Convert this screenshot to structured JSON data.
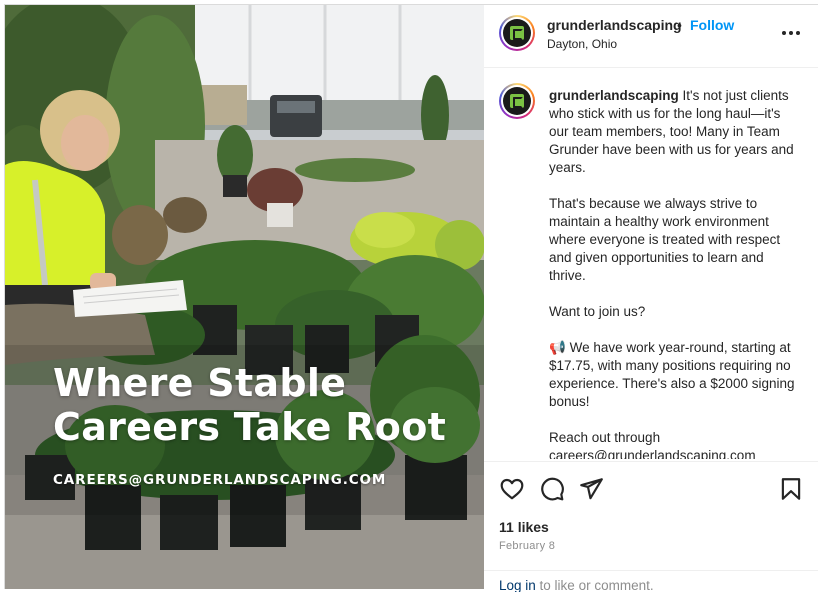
{
  "post": {
    "headline_line1": "Where Stable",
    "headline_line2": "Careers Take Root",
    "email_overlay": "CAREERS@GRUNDERLANDSCAPING.COM"
  },
  "header": {
    "username": "grunderlandscaping",
    "separator": "•",
    "follow_label": "Follow",
    "location": "Dayton, Ohio",
    "more_icon": "more-horizontal-icon"
  },
  "caption": {
    "username": "grunderlandscaping",
    "p1": "It's not just clients who stick with us for the long haul—it's our team members, too! Many in Team Grunder have been with us for years and years.",
    "p2": "That's because we always strive to maintain a healthy work environment where everyone is treated with respect and given opportunities to learn and thrive.",
    "p3": "Want to join us?",
    "p4_emoji": "📢",
    "p4": "We have work year-round, starting at $17.75, with many positions requiring no experience. There's also a $2000 signing bonus!",
    "p5": "Reach out through careers@grunderlandscaping.com"
  },
  "actions": {
    "like_icon": "heart-icon",
    "comment_icon": "comment-icon",
    "share_icon": "send-icon",
    "save_icon": "bookmark-icon",
    "likes": "11 likes",
    "date": "February 8",
    "login_link": "Log in",
    "login_suffix": " to like or comment."
  },
  "colors": {
    "accent": "#0095f6",
    "brand_green": "#7bc143",
    "vest_yellow": "#d7f02a"
  }
}
